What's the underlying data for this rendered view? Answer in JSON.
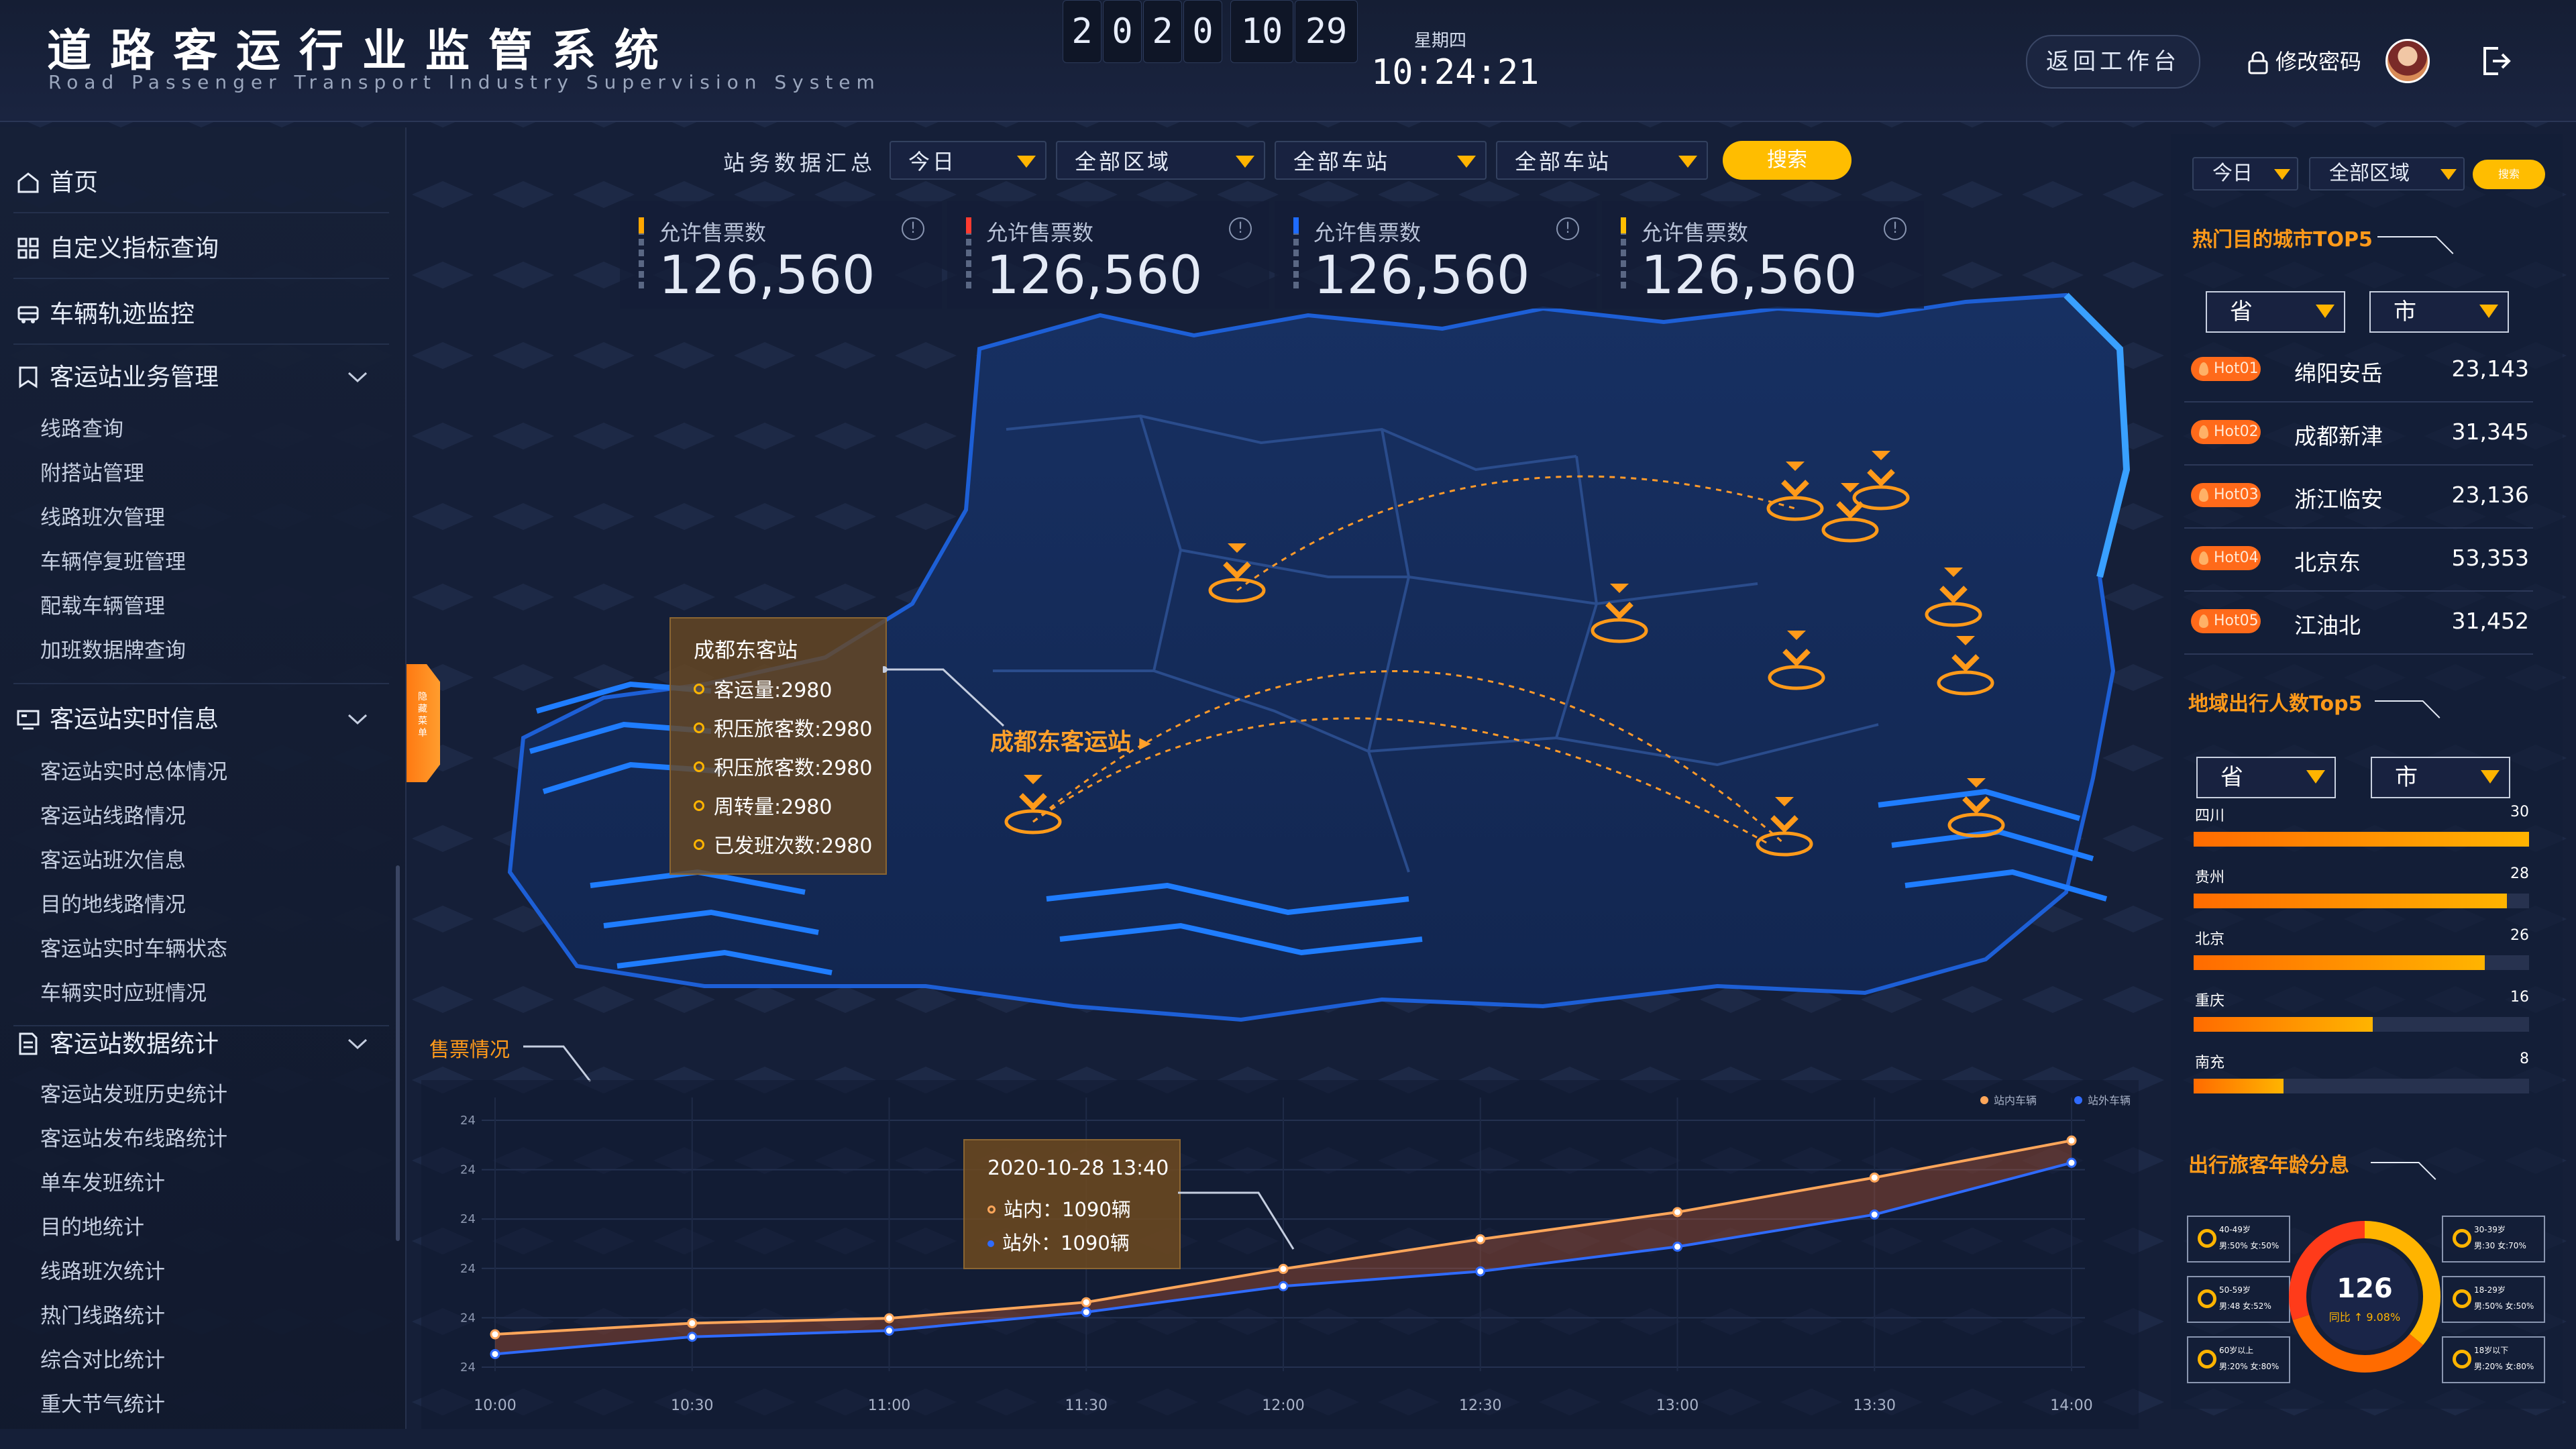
{
  "header": {
    "title": "道路客运行业监管系统",
    "subtitle": "Road Passenger Transport Industry Supervision System",
    "date_digits": [
      "2",
      "0",
      "2",
      "0"
    ],
    "hour": "10",
    "minute": "29",
    "weekday": "星期四",
    "clock": "10:24:21",
    "return_label": "返回工作台",
    "change_password_label": "修改密码"
  },
  "sidebar": {
    "items": [
      {
        "label": "首页",
        "icon": "home-icon"
      },
      {
        "label": "自定义指标查询",
        "icon": "grid-icon"
      },
      {
        "label": "车辆轨迹监控",
        "icon": "bus-icon"
      }
    ],
    "groups": [
      {
        "label": "客运站业务管理",
        "icon": "bookmark-icon",
        "children": [
          "线路查询",
          "附搭站管理",
          "线路班次管理",
          "车辆停复班管理",
          "配载车辆管理",
          "加班数据牌查询"
        ]
      },
      {
        "label": "客运站实时信息",
        "icon": "monitor-icon",
        "children": [
          "客运站实时总体情况",
          "客运站线路情况",
          "客运站班次信息",
          "目的地线路情况",
          "客运站实时车辆状态",
          "车辆实时应班情况"
        ]
      },
      {
        "label": "客运站数据统计",
        "icon": "document-icon",
        "children": [
          "客运站发班历史统计",
          "客运站发布线路统计",
          "单车发班统计",
          "目的地统计",
          "线路班次统计",
          "热门线路统计",
          "综合对比统计",
          "重大节气统计"
        ]
      }
    ],
    "collapse_label": "隐藏菜单"
  },
  "filters": {
    "label": "站务数据汇总",
    "selects": [
      "今日",
      "全部区域",
      "全部车站",
      "全部车站"
    ],
    "search_label": "搜索"
  },
  "kpis": [
    {
      "label": "允许售票数",
      "value": "126,560",
      "accent": "#ffa600"
    },
    {
      "label": "允许售票数",
      "value": "126,560",
      "accent": "#ff3b30"
    },
    {
      "label": "允许售票数",
      "value": "126,560",
      "accent": "#1e6bff"
    },
    {
      "label": "允许售票数",
      "value": "126,560",
      "accent": "#ffbd00"
    }
  ],
  "map": {
    "station_tooltip": {
      "title": "成都东客站",
      "rows": [
        "客运量:2980",
        "积压旅客数:2980",
        "积压旅客数:2980",
        "周转量:2980",
        "已发班次数:2980"
      ]
    },
    "station_label": "成都东客运站"
  },
  "sales_chart": {
    "title": "售票情况",
    "tooltip": {
      "time": "2020-10-28 13:40",
      "inside": "站内：1090辆",
      "outside": "站外：1090辆"
    }
  },
  "chart_data": {
    "type": "area",
    "title": "售票情况",
    "x": [
      "10:00",
      "10:30",
      "11:00",
      "11:30",
      "12:00",
      "12:30",
      "13:00",
      "13:30",
      "14:00"
    ],
    "y_tick_labels": [
      "24",
      "24",
      "24",
      "24",
      "24",
      "24"
    ],
    "legend_position": "top-right",
    "series": [
      {
        "name": "站内车辆",
        "color": "#ffa65a",
        "values": [
          9.5,
          14,
          16,
          22.5,
          36,
          48,
          59,
          73,
          88
        ]
      },
      {
        "name": "站外车辆",
        "color": "#2f6bff",
        "values": [
          1.5,
          8.5,
          11,
          18.5,
          29,
          35,
          45,
          58,
          79
        ]
      }
    ],
    "ylim": [
      0,
      100
    ]
  },
  "right": {
    "filters": {
      "day": "今日",
      "region": "全部区域",
      "search_label": "搜索"
    },
    "hot_title": "热门目的城市TOP5",
    "province_label": "省",
    "city_label": "市",
    "hot": [
      {
        "rank": "Hot01",
        "name": "绵阳安岳",
        "value": "23,143"
      },
      {
        "rank": "Hot02",
        "name": "成都新津",
        "value": "31,345"
      },
      {
        "rank": "Hot03",
        "name": "浙江临安",
        "value": "23,136"
      },
      {
        "rank": "Hot04",
        "name": "北京东",
        "value": "53,353"
      },
      {
        "rank": "Hot05",
        "name": "江油北",
        "value": "31,452"
      }
    ],
    "region_title": "地域出行人数Top5",
    "regions": [
      {
        "name": "四川",
        "value": 30
      },
      {
        "name": "贵州",
        "value": 28
      },
      {
        "name": "北京",
        "value": 26
      },
      {
        "name": "重庆",
        "value": 16
      },
      {
        "name": "南充",
        "value": 8
      }
    ],
    "age_title": "出行旅客年龄分息",
    "age_total": "126",
    "age_sub": "同比 ↑ 9.08%",
    "age_groups": [
      {
        "range": "40-49岁",
        "detail": "男:50% 女:50%"
      },
      {
        "range": "30-39岁",
        "detail": "男:30 女:70%"
      },
      {
        "range": "50-59岁",
        "detail": "男:48 女:52%"
      },
      {
        "range": "18-29岁",
        "detail": "男:50% 女:50%"
      },
      {
        "range": "60岁以上",
        "detail": "男:20% 女:80%"
      },
      {
        "range": "18岁以下",
        "detail": "男:20% 女:80%"
      }
    ],
    "age_colors": [
      "#ffb400",
      "#ff6b00",
      "#ff3b1a"
    ]
  }
}
